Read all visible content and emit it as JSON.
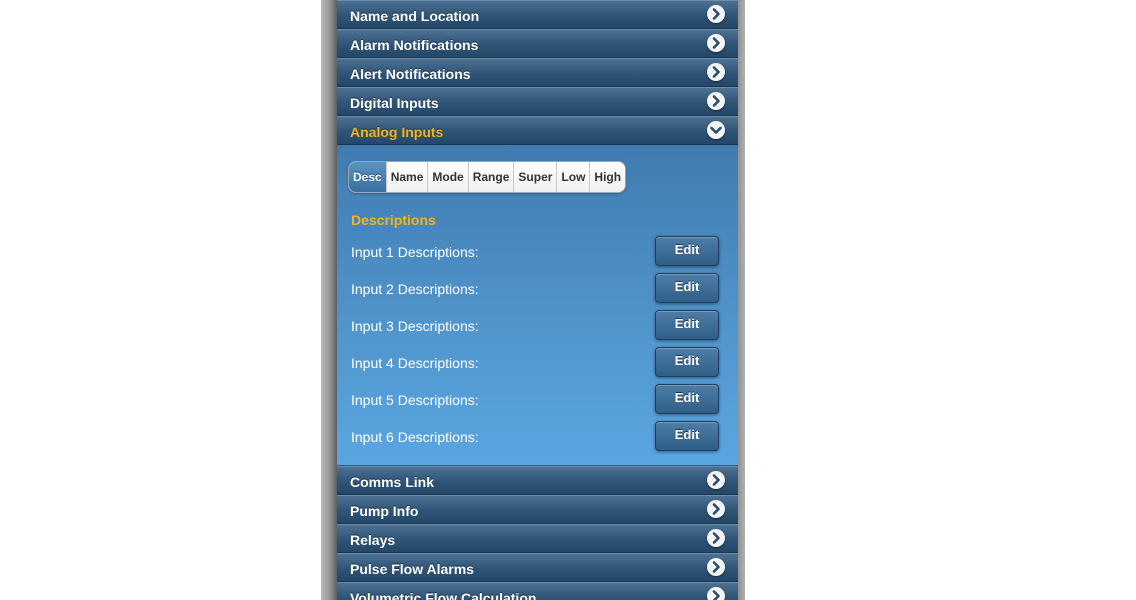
{
  "accordion_top": [
    {
      "label": "Name and Location",
      "icon": "chevron-right-icon"
    },
    {
      "label": "Alarm Notifications",
      "icon": "chevron-right-icon"
    },
    {
      "label": "Alert Notifications",
      "icon": "chevron-right-icon"
    },
    {
      "label": "Digital Inputs",
      "icon": "chevron-right-icon"
    }
  ],
  "analog": {
    "label": "Analog Inputs",
    "icon": "chevron-down-icon",
    "tabs": [
      {
        "label": "Desc",
        "active": true
      },
      {
        "label": "Name",
        "active": false
      },
      {
        "label": "Mode",
        "active": false
      },
      {
        "label": "Range",
        "active": false
      },
      {
        "label": "Super",
        "active": false
      },
      {
        "label": "Low",
        "active": false
      },
      {
        "label": "High",
        "active": false
      }
    ],
    "section_heading": "Descriptions",
    "rows": [
      {
        "label": "Input 1 Descriptions:",
        "button": "Edit"
      },
      {
        "label": "Input 2 Descriptions:",
        "button": "Edit"
      },
      {
        "label": "Input 3 Descriptions:",
        "button": "Edit"
      },
      {
        "label": "Input 4 Descriptions:",
        "button": "Edit"
      },
      {
        "label": "Input 5 Descriptions:",
        "button": "Edit"
      },
      {
        "label": "Input 6 Descriptions:",
        "button": "Edit"
      }
    ]
  },
  "accordion_bottom": [
    {
      "label": "Comms Link",
      "icon": "chevron-right-icon"
    },
    {
      "label": "Pump Info",
      "icon": "chevron-right-icon"
    },
    {
      "label": "Relays",
      "icon": "chevron-right-icon"
    },
    {
      "label": "Pulse Flow Alarms",
      "icon": "chevron-right-icon"
    },
    {
      "label": "Volumetric Flow Calculation",
      "icon": "chevron-right-icon"
    }
  ],
  "colors": {
    "header_text": "#ffffff",
    "active_header_text": "#f3b51a",
    "panel_blue": "#4f92c9",
    "header_bar": "#2e5476"
  }
}
